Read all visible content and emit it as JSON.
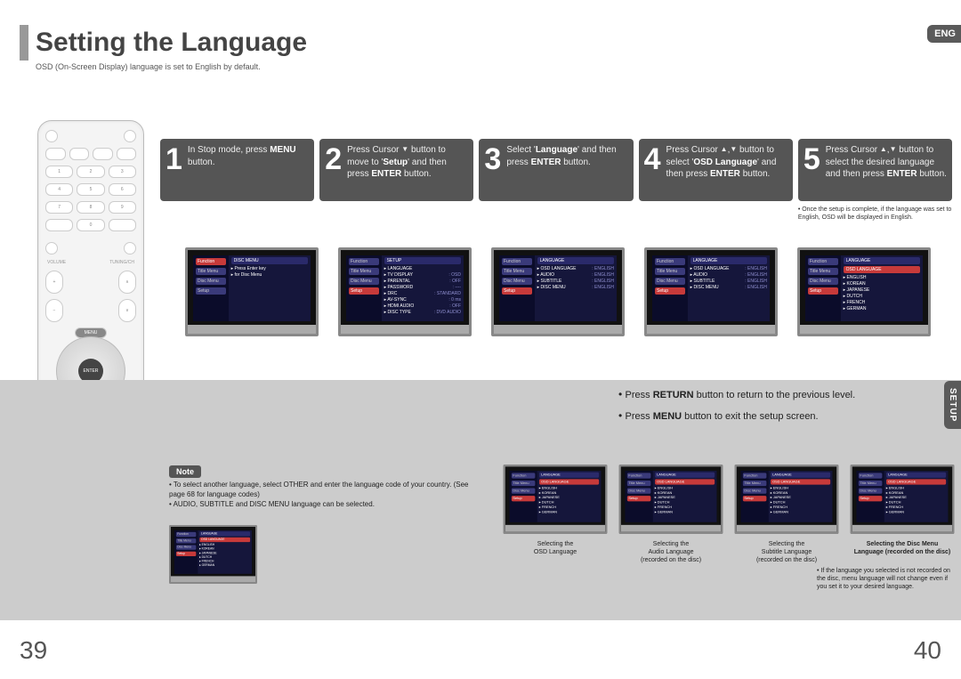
{
  "lang_badge": "ENG",
  "header": {
    "title": "Setting the Language",
    "subtitle": "OSD (On-Screen Display) language is set to English by default."
  },
  "steps": [
    {
      "num": "1",
      "html": "In Stop mode, press <b>MENU</b> button."
    },
    {
      "num": "2",
      "html": "Press Cursor <span class='tri-down'>▼</span> button to move to '<b>Setup</b>' and then press <b>ENTER</b> button."
    },
    {
      "num": "3",
      "html": "Select '<b>Language</b>' and then press <b>ENTER</b> button."
    },
    {
      "num": "4",
      "html": "Press Cursor <span class='tri-up'>▲</span>,<span class='tri-down'>▼</span> button to select '<b>OSD Language</b>' and then press <b>ENTER</b> button."
    },
    {
      "num": "5",
      "html": "Press Cursor <span class='tri-up'>▲</span>,<span class='tri-down'>▼</span> button to select the desired language and then press <b>ENTER</b> button.",
      "hint": "Once the setup is complete, if the language was set to English, OSD will be displayed in English."
    }
  ],
  "tv_menus": {
    "left_tabs": [
      "Function",
      "Title Menu",
      "Disc Menu",
      "Setup"
    ],
    "screen2": {
      "header": "SETUP",
      "rows": [
        [
          "LANGUAGE",
          ""
        ],
        [
          "TV DISPLAY",
          ": OSD"
        ],
        [
          "PARENTAL",
          ": OFF"
        ],
        [
          "PASSWORD",
          ": ----"
        ],
        [
          "DRC",
          ": STANDARD"
        ],
        [
          "AV-SYNC",
          ": 0 ms"
        ],
        [
          "HDMI AUDIO",
          ": OFF"
        ],
        [
          "DISC TYPE",
          ": DVD AUDIO"
        ]
      ]
    },
    "screen3": {
      "header": "LANGUAGE",
      "rows": [
        [
          "OSD LANGUAGE",
          ": ENGLISH"
        ],
        [
          "AUDIO",
          ": ENGLISH"
        ],
        [
          "SUBTITLE",
          ": ENGLISH"
        ],
        [
          "DISC MENU",
          ": ENGLISH"
        ]
      ]
    },
    "screen5": {
      "header": "LANGUAGE",
      "sub": "OSD LANGUAGE",
      "rows": [
        [
          "ENGLISH",
          ""
        ],
        [
          "KOREAN",
          ""
        ],
        [
          "JAPANESE",
          ""
        ],
        [
          "DUTCH",
          ""
        ],
        [
          "FRENCH",
          ""
        ],
        [
          "GERMAN",
          ""
        ]
      ]
    }
  },
  "return_menu": {
    "line1": "Press RETURN button to return to the previous level.",
    "line2": "Press MENU button to exit the setup screen."
  },
  "side_tab": "SETUP",
  "note": {
    "label": "Note",
    "lines": [
      "To select another language, select OTHER and enter the language code of your country. (See page 68 for language codes)",
      "AUDIO, SUBTITLE and DISC MENU language can be selected."
    ]
  },
  "lower_captions": [
    "Selecting the\nOSD Language",
    "Selecting the\nAudio Language\n(recorded on the disc)",
    "Selecting the\nSubtitle Language\n(recorded on the disc)",
    "Selecting the Disc Menu\nLanguage (recorded on the disc)"
  ],
  "lower_footnote": "If the language you selected is not recorded on the disc, menu language will not change even if you set it to your desired language.",
  "page_numbers": {
    "left": "39",
    "right": "40"
  }
}
